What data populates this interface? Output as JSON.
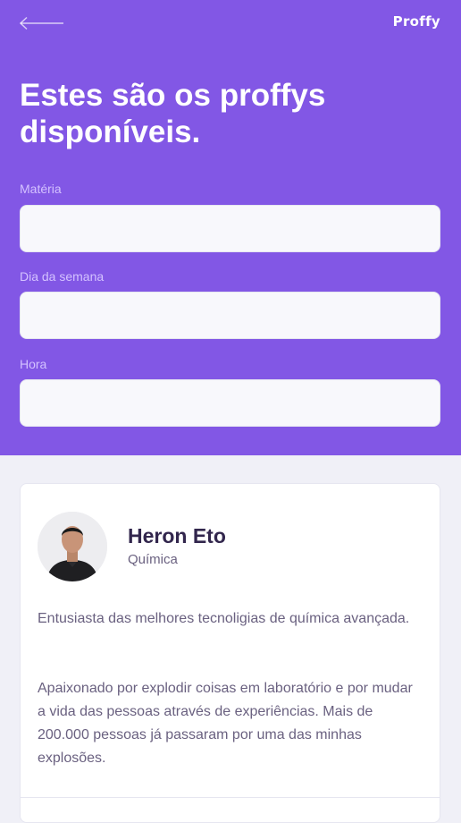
{
  "header": {
    "logo": "Proffy",
    "title": "Estes são os proffys disponíveis."
  },
  "filters": {
    "subject": {
      "label": "Matéria",
      "value": ""
    },
    "weekday": {
      "label": "Dia da semana",
      "value": ""
    },
    "time": {
      "label": "Hora",
      "value": ""
    }
  },
  "teacher": {
    "name": "Heron Eto",
    "subject": "Química",
    "bio_1": "Entusiasta das melhores tecnoligias de química avançada.",
    "bio_2": "Apaixonado por explodir coisas em laboratório e por mudar a vida das pessoas através de experiências. Mais de 200.000 pessoas já passaram por uma das minhas explosões."
  },
  "icons": {
    "back": "arrow-left-icon"
  },
  "colors": {
    "primary": "#8257E5",
    "background": "#F0F0F7",
    "input": "#F8F8FC",
    "label": "#D4C2FF",
    "title_dark": "#32264D",
    "text": "#6A6180"
  }
}
